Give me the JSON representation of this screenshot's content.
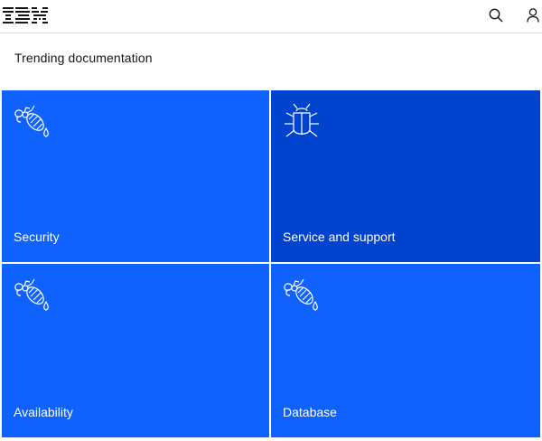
{
  "header": {
    "logo_text": "IBM",
    "search_icon": "search-icon",
    "user_icon": "user-icon"
  },
  "section": {
    "heading": "Trending documentation"
  },
  "tiles": [
    {
      "label": "Security",
      "icon": "bee-icon",
      "color": "#0f62fe"
    },
    {
      "label": "Service and support",
      "icon": "bug-icon",
      "color": "#0043ce"
    },
    {
      "label": "Availability",
      "icon": "bee-icon",
      "color": "#0f62fe"
    },
    {
      "label": "Database",
      "icon": "bee-icon",
      "color": "#0f62fe"
    }
  ],
  "colors": {
    "primary_blue": "#0f62fe",
    "hover_blue": "#0043ce",
    "text_dark": "#161616",
    "divider": "#e0e0e0"
  }
}
